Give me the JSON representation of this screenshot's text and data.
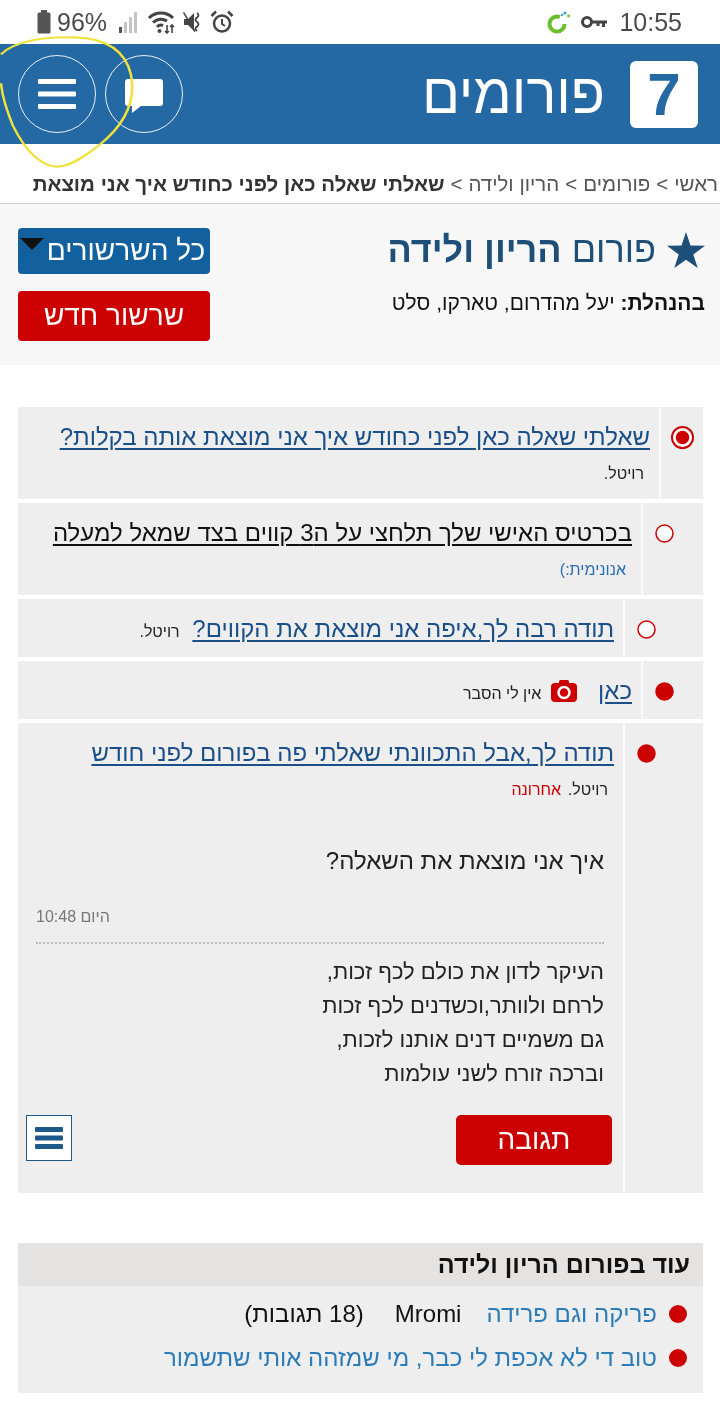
{
  "status_bar": {
    "battery": "96%",
    "time": "10:55"
  },
  "header": {
    "logo": "7",
    "title": "פורומים"
  },
  "breadcrumb": [
    {
      "label": "ראשי",
      "separator": ">",
      "current": false
    },
    {
      "label": "פורומים",
      "separator": ">",
      "current": false
    },
    {
      "label": "הריון ולידה",
      "separator": ">",
      "current": false
    },
    {
      "label": "שאלתי שאלה כאן לפני כחודש איך אני מוצאת",
      "current": true
    }
  ],
  "forum": {
    "title": "פורום **הריון ולידה**",
    "moderators": "**בהנהלת:** יעל מהדרום, טארקו, סלט",
    "all_threads_button": "כל השרשורים",
    "new_thread_button": "שרשור חדש"
  },
  "thread": {
    "messages": [
      {
        "title": "שאלתי שאלה כאן לפני כחודש איך אני מוצאת אותה בקלות?",
        "author": "רויטל.",
        "selected": true,
        "read": false,
        "visited": false,
        "author_link": false,
        "has_image": false,
        "children": [
          {
            "title": "בכרטיס האישי שלך תלחצי על ה3 קווים בצד שמאל למעלה",
            "author": "אנונימית:)",
            "selected": false,
            "read": true,
            "visited": true,
            "author_link": true,
            "has_image": false,
            "children": [
              {
                "title": "תודה רבה לך,איפה אני מוצאת את הקווים?",
                "author": "רויטל.",
                "selected": false,
                "read": true,
                "visited": false,
                "author_link": false,
                "has_image": false
              }
            ]
          },
          {
            "title": "כאן",
            "author": "אין לי הסבר",
            "selected": false,
            "read": false,
            "visited": false,
            "author_link": false,
            "has_image": true,
            "children": [
              {
                "title": "תודה לך,אבל התכוונתי שאלתי פה בפורום לפני חודש",
                "author": "רויטל.",
                "latest_label": "אחרונה",
                "selected": false,
                "read": false,
                "visited": false,
                "author_link": false,
                "has_image": false,
                "post": {
                  "text": "איך אני מוצאת את השאלה?",
                  "time": "היום 10:48",
                  "signature": "העיקר לדון את כולם לכף זכות,\nלרחם ולוותר,וכשדנים לכף זכות\nגם משמיים דנים אותנו לזכות,\nוברכה זורח לשני עולמות",
                  "reply_button": "תגובה"
                }
              }
            ]
          }
        ]
      }
    ]
  },
  "more_in_forum": {
    "title": "עוד בפורום הריון ולידה",
    "items": [
      {
        "title": "פריקה וגם פרידה",
        "author": "Mromi",
        "replies": "(18 תגובות)"
      },
      {
        "title": "טוב די לא אכפת לי כבר, מי שמזהה אותי שתשמור"
      }
    ]
  }
}
